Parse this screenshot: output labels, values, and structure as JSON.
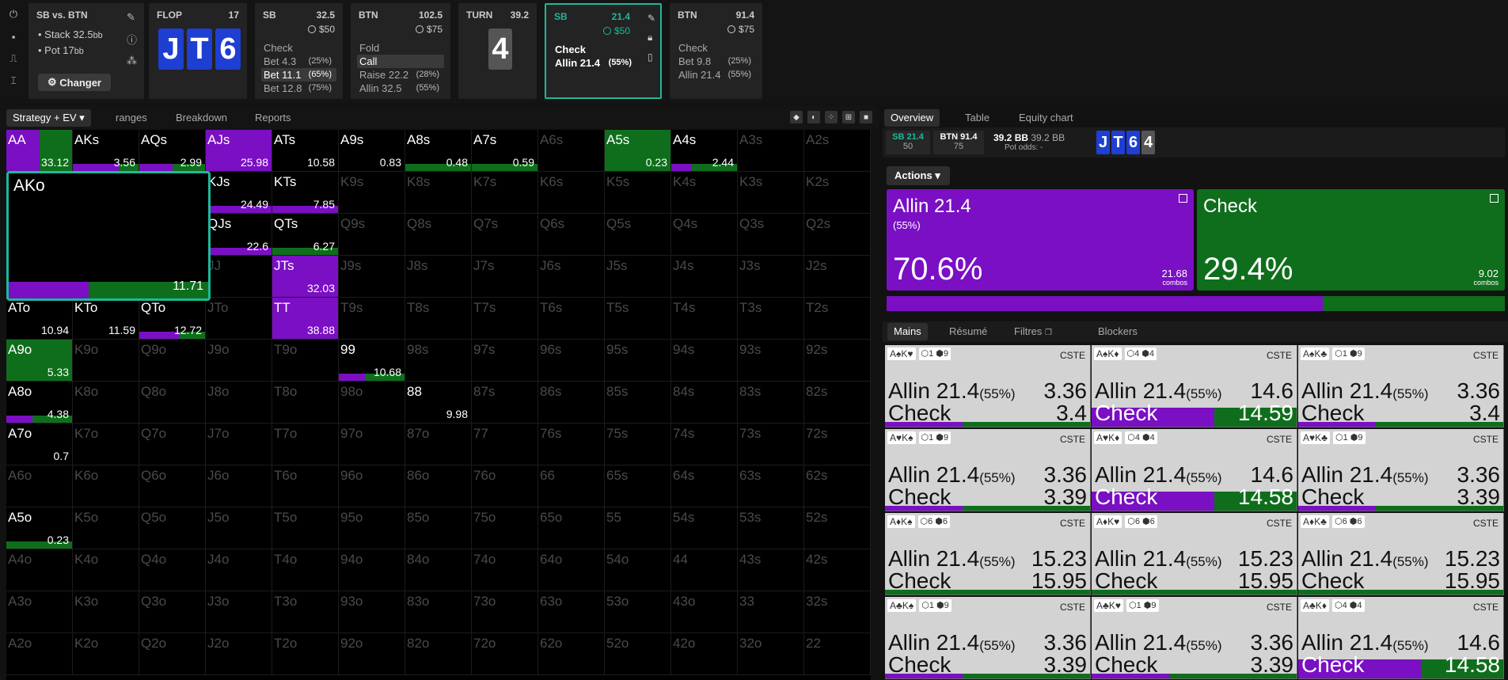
{
  "colors": {
    "allin": "#7a0fc4",
    "check": "#0f6e1c",
    "accent": "#1db89a"
  },
  "left_icons": [
    "power-icon",
    "save-icon",
    "gamepad-icon",
    "text-cursor-icon"
  ],
  "spot": {
    "title": "SB vs. BTN",
    "stack_label": "Stack 32.5",
    "stack_unit": "bb",
    "pot_label": "Pot 17",
    "pot_unit": "bb",
    "changer": "Changer"
  },
  "flop": {
    "title": "FLOP",
    "value": "17",
    "cards": [
      "J",
      "T",
      "6"
    ]
  },
  "sb1": {
    "title": "SB",
    "value": "32.5",
    "sub": "$50",
    "actions": [
      {
        "label": "Check",
        "pct": ""
      },
      {
        "label": "Bet 4.3",
        "pct": "(25%)"
      },
      {
        "label": "Bet 11.1",
        "pct": "(65%)"
      },
      {
        "label": "Bet 12.8",
        "pct": "(75%)"
      }
    ]
  },
  "btn1": {
    "title": "BTN",
    "value": "102.5",
    "sub": "$75",
    "actions": [
      {
        "label": "Fold",
        "pct": ""
      },
      {
        "label": "Call",
        "pct": ""
      },
      {
        "label": "Raise 22.2",
        "pct": "(28%)"
      },
      {
        "label": "Allin 32.5",
        "pct": "(55%)"
      }
    ]
  },
  "turn": {
    "title": "TURN",
    "value": "39.2",
    "card": "4"
  },
  "sb2": {
    "title": "SB",
    "value": "21.4",
    "sub": "$50",
    "actions": [
      {
        "label": "Check",
        "pct": ""
      },
      {
        "label": "Allin 21.4",
        "pct": "(55%)"
      }
    ]
  },
  "btn2": {
    "title": "BTN",
    "value": "91.4",
    "sub": "$75",
    "actions": [
      {
        "label": "Check",
        "pct": ""
      },
      {
        "label": "Bet 9.8",
        "pct": "(25%)"
      },
      {
        "label": "Allin 21.4",
        "pct": "(55%)"
      }
    ]
  },
  "left_tabs": [
    "Strategy + EV",
    "ranges",
    "Breakdown",
    "Reports"
  ],
  "grid": {
    "big_cell": {
      "name": "AKo",
      "ev": "11.71",
      "allin": 0.4,
      "check": 0.6
    }
  },
  "right_tabs": [
    "Overview",
    "Table",
    "Equity chart"
  ],
  "info": {
    "sb": "SB 21.4",
    "sb_sub": "50",
    "btn": "BTN 91.4",
    "btn_sub": "75",
    "pot": "39.2 BB",
    "pot2": "39.2 BB",
    "pot_odds": "Pot odds: -",
    "cards": [
      "J",
      "T",
      "6",
      "4"
    ]
  },
  "actions_btn": "Actions",
  "allin": {
    "label": "Allin 21.4",
    "size": "(55%)",
    "pct": "70.6%",
    "combos": "21.68",
    "combos_unit": "combos"
  },
  "check": {
    "label": "Check",
    "pct": "29.4%",
    "combos": "9.02",
    "combos_unit": "combos"
  },
  "hand_tabs": [
    "Mains",
    "Résumé",
    "Filtres",
    "Blockers"
  ],
  "hands": [
    {
      "cards": "A♠K♥",
      "b1": "1",
      "b2": "9",
      "cste": "CSTE",
      "a": "Allin 21.4",
      "a_pct": "(55%)",
      "av": "3.36",
      "c": "Check",
      "cv": "3.4",
      "allin": 0.38,
      "thick": false
    },
    {
      "cards": "A♠K♦",
      "b1": "4",
      "b2": "4",
      "cste": "CSTE",
      "a": "Allin 21.4",
      "a_pct": "(55%)",
      "av": "14.6",
      "c": "Check",
      "cv": "14.59",
      "allin": 0.6,
      "thick": true
    },
    {
      "cards": "A♠K♣",
      "b1": "1",
      "b2": "9",
      "cste": "CSTE",
      "a": "Allin 21.4",
      "a_pct": "(55%)",
      "av": "3.36",
      "c": "Check",
      "cv": "3.4",
      "allin": 0.38,
      "thick": false
    },
    {
      "cards": "A♥K♠",
      "b1": "1",
      "b2": "9",
      "cste": "CSTE",
      "a": "Allin 21.4",
      "a_pct": "(55%)",
      "av": "3.36",
      "c": "Check",
      "cv": "3.39",
      "allin": 0.38,
      "thick": false
    },
    {
      "cards": "A♥K♦",
      "b1": "4",
      "b2": "4",
      "cste": "CSTE",
      "a": "Allin 21.4",
      "a_pct": "(55%)",
      "av": "14.6",
      "c": "Check",
      "cv": "14.58",
      "allin": 0.6,
      "thick": true
    },
    {
      "cards": "A♥K♣",
      "b1": "1",
      "b2": "9",
      "cste": "CSTE",
      "a": "Allin 21.4",
      "a_pct": "(55%)",
      "av": "3.36",
      "c": "Check",
      "cv": "3.39",
      "allin": 0.38,
      "thick": false
    },
    {
      "cards": "A♦K♠",
      "b1": "6",
      "b2": "6",
      "cste": "CSTE",
      "a": "Allin 21.4",
      "a_pct": "(55%)",
      "av": "15.23",
      "c": "Check",
      "cv": "15.95",
      "allin": 0.0,
      "thick": false
    },
    {
      "cards": "A♦K♥",
      "b1": "6",
      "b2": "6",
      "cste": "CSTE",
      "a": "Allin 21.4",
      "a_pct": "(55%)",
      "av": "15.23",
      "c": "Check",
      "cv": "15.95",
      "allin": 0.0,
      "thick": false
    },
    {
      "cards": "A♦K♣",
      "b1": "6",
      "b2": "6",
      "cste": "CSTE",
      "a": "Allin 21.4",
      "a_pct": "(55%)",
      "av": "15.23",
      "c": "Check",
      "cv": "15.95",
      "allin": 0.0,
      "thick": false
    },
    {
      "cards": "A♣K♠",
      "b1": "1",
      "b2": "9",
      "cste": "CSTE",
      "a": "Allin 21.4",
      "a_pct": "(55%)",
      "av": "3.36",
      "c": "Check",
      "cv": "3.39",
      "allin": 0.38,
      "thick": false
    },
    {
      "cards": "A♣K♥",
      "b1": "1",
      "b2": "9",
      "cste": "CSTE",
      "a": "Allin 21.4",
      "a_pct": "(55%)",
      "av": "3.36",
      "c": "Check",
      "cv": "3.39",
      "allin": 0.38,
      "thick": false
    },
    {
      "cards": "A♣K♦",
      "b1": "4",
      "b2": "4",
      "cste": "CSTE",
      "a": "Allin 21.4",
      "a_pct": "(55%)",
      "av": "14.6",
      "c": "Check",
      "cv": "14.58",
      "allin": 0.6,
      "thick": true
    }
  ],
  "grid_cells": [
    {
      "r": 0,
      "c": 0,
      "name": "AA",
      "ev": "33.12",
      "allin": 0.5,
      "check": 0.5,
      "full": true
    },
    {
      "r": 0,
      "c": 1,
      "name": "AKs",
      "ev": "3.56",
      "allin": 0.7,
      "check": 0.3
    },
    {
      "r": 0,
      "c": 2,
      "name": "AQs",
      "ev": "2.99",
      "allin": 0.5,
      "check": 0.5
    },
    {
      "r": 0,
      "c": 3,
      "name": "AJs",
      "ev": "25.98",
      "allin": 1,
      "check": 0,
      "full": true
    },
    {
      "r": 0,
      "c": 4,
      "name": "ATs",
      "ev": "10.58",
      "allin": 0,
      "check": 0
    },
    {
      "r": 0,
      "c": 5,
      "name": "A9s",
      "ev": "0.83",
      "allin": 0,
      "check": 0
    },
    {
      "r": 0,
      "c": 6,
      "name": "A8s",
      "ev": "0.48",
      "allin": 0,
      "check": 1
    },
    {
      "r": 0,
      "c": 7,
      "name": "A7s",
      "ev": "0.59",
      "allin": 0,
      "check": 1
    },
    {
      "r": 0,
      "c": 8,
      "name": "A6s",
      "dim": true
    },
    {
      "r": 0,
      "c": 9,
      "name": "A5s",
      "ev": "0.23",
      "allin": 0,
      "check": 1,
      "full": true
    },
    {
      "r": 0,
      "c": 10,
      "name": "A4s",
      "ev": "2.44",
      "allin": 0.3,
      "check": 0.7
    },
    {
      "r": 0,
      "c": 11,
      "name": "A3s",
      "dim": true
    },
    {
      "r": 0,
      "c": 12,
      "name": "A2s",
      "dim": true
    },
    {
      "r": 1,
      "c": 3,
      "name": "KJs",
      "ev": "24.49",
      "allin": 1,
      "check": 0
    },
    {
      "r": 1,
      "c": 4,
      "name": "KTs",
      "ev": "7.85",
      "allin": 1,
      "check": 0
    },
    {
      "r": 1,
      "c": 5,
      "name": "K9s",
      "dim": true
    },
    {
      "r": 1,
      "c": 6,
      "name": "K8s",
      "dim": true
    },
    {
      "r": 1,
      "c": 7,
      "name": "K7s",
      "dim": true
    },
    {
      "r": 1,
      "c": 8,
      "name": "K6s",
      "dim": true
    },
    {
      "r": 1,
      "c": 9,
      "name": "K5s",
      "dim": true
    },
    {
      "r": 1,
      "c": 10,
      "name": "K4s",
      "dim": true
    },
    {
      "r": 1,
      "c": 11,
      "name": "K3s",
      "dim": true
    },
    {
      "r": 1,
      "c": 12,
      "name": "K2s",
      "dim": true
    },
    {
      "r": 2,
      "c": 3,
      "name": "QJs",
      "ev": "22.6",
      "allin": 1,
      "check": 0
    },
    {
      "r": 2,
      "c": 4,
      "name": "QTs",
      "ev": "6.27",
      "allin": 0,
      "check": 1
    },
    {
      "r": 2,
      "c": 5,
      "name": "Q9s",
      "dim": true
    },
    {
      "r": 2,
      "c": 6,
      "name": "Q8s",
      "dim": true
    },
    {
      "r": 2,
      "c": 7,
      "name": "Q7s",
      "dim": true
    },
    {
      "r": 2,
      "c": 8,
      "name": "Q6s",
      "dim": true
    },
    {
      "r": 2,
      "c": 9,
      "name": "Q5s",
      "dim": true
    },
    {
      "r": 2,
      "c": 10,
      "name": "Q4s",
      "dim": true
    },
    {
      "r": 2,
      "c": 11,
      "name": "Q3s",
      "dim": true
    },
    {
      "r": 2,
      "c": 12,
      "name": "Q2s",
      "dim": true
    },
    {
      "r": 3,
      "c": 3,
      "name": "JJ",
      "dim": true
    },
    {
      "r": 3,
      "c": 4,
      "name": "JTs",
      "ev": "32.03",
      "allin": 1,
      "check": 0,
      "full": true
    },
    {
      "r": 3,
      "c": 5,
      "name": "J9s",
      "dim": true
    },
    {
      "r": 3,
      "c": 6,
      "name": "J8s",
      "dim": true
    },
    {
      "r": 3,
      "c": 7,
      "name": "J7s",
      "dim": true
    },
    {
      "r": 3,
      "c": 8,
      "name": "J6s",
      "dim": true
    },
    {
      "r": 3,
      "c": 9,
      "name": "J5s",
      "dim": true
    },
    {
      "r": 3,
      "c": 10,
      "name": "J4s",
      "dim": true
    },
    {
      "r": 3,
      "c": 11,
      "name": "J3s",
      "dim": true
    },
    {
      "r": 3,
      "c": 12,
      "name": "J2s",
      "dim": true
    },
    {
      "r": 4,
      "c": 0,
      "name": "ATo",
      "ev": "10.94",
      "allin": 0,
      "check": 0
    },
    {
      "r": 4,
      "c": 1,
      "name": "KTo",
      "ev": "11.59",
      "allin": 0,
      "check": 0
    },
    {
      "r": 4,
      "c": 2,
      "name": "QTo",
      "ev": "12.72",
      "allin": 0.6,
      "check": 0.4
    },
    {
      "r": 4,
      "c": 3,
      "name": "JTo",
      "dim": true
    },
    {
      "r": 4,
      "c": 4,
      "name": "TT",
      "ev": "38.88",
      "allin": 1,
      "check": 0,
      "full": true
    },
    {
      "r": 4,
      "c": 5,
      "name": "T9s",
      "dim": true
    },
    {
      "r": 4,
      "c": 6,
      "name": "T8s",
      "dim": true
    },
    {
      "r": 4,
      "c": 7,
      "name": "T7s",
      "dim": true
    },
    {
      "r": 4,
      "c": 8,
      "name": "T6s",
      "dim": true
    },
    {
      "r": 4,
      "c": 9,
      "name": "T5s",
      "dim": true
    },
    {
      "r": 4,
      "c": 10,
      "name": "T4s",
      "dim": true
    },
    {
      "r": 4,
      "c": 11,
      "name": "T3s",
      "dim": true
    },
    {
      "r": 4,
      "c": 12,
      "name": "T2s",
      "dim": true
    },
    {
      "r": 5,
      "c": 0,
      "name": "A9o",
      "ev": "5.33",
      "allin": 0,
      "check": 1,
      "full": true
    },
    {
      "r": 5,
      "c": 1,
      "name": "K9o",
      "dim": true
    },
    {
      "r": 5,
      "c": 2,
      "name": "Q9o",
      "dim": true
    },
    {
      "r": 5,
      "c": 3,
      "name": "J9o",
      "dim": true
    },
    {
      "r": 5,
      "c": 4,
      "name": "T9o",
      "dim": true
    },
    {
      "r": 5,
      "c": 5,
      "name": "99",
      "ev": "10.68",
      "allin": 0.4,
      "check": 0.6
    },
    {
      "r": 5,
      "c": 6,
      "name": "98s",
      "dim": true
    },
    {
      "r": 5,
      "c": 7,
      "name": "97s",
      "dim": true
    },
    {
      "r": 5,
      "c": 8,
      "name": "96s",
      "dim": true
    },
    {
      "r": 5,
      "c": 9,
      "name": "95s",
      "dim": true
    },
    {
      "r": 5,
      "c": 10,
      "name": "94s",
      "dim": true
    },
    {
      "r": 5,
      "c": 11,
      "name": "93s",
      "dim": true
    },
    {
      "r": 5,
      "c": 12,
      "name": "92s",
      "dim": true
    },
    {
      "r": 6,
      "c": 0,
      "name": "A8o",
      "ev": "4.38",
      "allin": 0.4,
      "check": 0.6
    },
    {
      "r": 6,
      "c": 1,
      "name": "K8o",
      "dim": true
    },
    {
      "r": 6,
      "c": 2,
      "name": "Q8o",
      "dim": true
    },
    {
      "r": 6,
      "c": 3,
      "name": "J8o",
      "dim": true
    },
    {
      "r": 6,
      "c": 4,
      "name": "T8o",
      "dim": true
    },
    {
      "r": 6,
      "c": 5,
      "name": "98o",
      "dim": true
    },
    {
      "r": 6,
      "c": 6,
      "name": "88",
      "ev": "9.98",
      "allin": 0,
      "check": 0
    },
    {
      "r": 6,
      "c": 7,
      "name": "87s",
      "dim": true
    },
    {
      "r": 6,
      "c": 8,
      "name": "86s",
      "dim": true
    },
    {
      "r": 6,
      "c": 9,
      "name": "85s",
      "dim": true
    },
    {
      "r": 6,
      "c": 10,
      "name": "84s",
      "dim": true
    },
    {
      "r": 6,
      "c": 11,
      "name": "83s",
      "dim": true
    },
    {
      "r": 6,
      "c": 12,
      "name": "82s",
      "dim": true
    },
    {
      "r": 7,
      "c": 0,
      "name": "A7o",
      "ev": "0.7",
      "allin": 0,
      "check": 0
    },
    {
      "r": 7,
      "c": 1,
      "name": "K7o",
      "dim": true
    },
    {
      "r": 7,
      "c": 2,
      "name": "Q7o",
      "dim": true
    },
    {
      "r": 7,
      "c": 3,
      "name": "J7o",
      "dim": true
    },
    {
      "r": 7,
      "c": 4,
      "name": "T7o",
      "dim": true
    },
    {
      "r": 7,
      "c": 5,
      "name": "97o",
      "dim": true
    },
    {
      "r": 7,
      "c": 6,
      "name": "87o",
      "dim": true
    },
    {
      "r": 7,
      "c": 7,
      "name": "77",
      "dim": true
    },
    {
      "r": 7,
      "c": 8,
      "name": "76s",
      "dim": true
    },
    {
      "r": 7,
      "c": 9,
      "name": "75s",
      "dim": true
    },
    {
      "r": 7,
      "c": 10,
      "name": "74s",
      "dim": true
    },
    {
      "r": 7,
      "c": 11,
      "name": "73s",
      "dim": true
    },
    {
      "r": 7,
      "c": 12,
      "name": "72s",
      "dim": true
    },
    {
      "r": 8,
      "c": 0,
      "name": "A6o",
      "dim": true
    },
    {
      "r": 8,
      "c": 1,
      "name": "K6o",
      "dim": true
    },
    {
      "r": 8,
      "c": 2,
      "name": "Q6o",
      "dim": true
    },
    {
      "r": 8,
      "c": 3,
      "name": "J6o",
      "dim": true
    },
    {
      "r": 8,
      "c": 4,
      "name": "T6o",
      "dim": true
    },
    {
      "r": 8,
      "c": 5,
      "name": "96o",
      "dim": true
    },
    {
      "r": 8,
      "c": 6,
      "name": "86o",
      "dim": true
    },
    {
      "r": 8,
      "c": 7,
      "name": "76o",
      "dim": true
    },
    {
      "r": 8,
      "c": 8,
      "name": "66",
      "dim": true
    },
    {
      "r": 8,
      "c": 9,
      "name": "65s",
      "dim": true
    },
    {
      "r": 8,
      "c": 10,
      "name": "64s",
      "dim": true
    },
    {
      "r": 8,
      "c": 11,
      "name": "63s",
      "dim": true
    },
    {
      "r": 8,
      "c": 12,
      "name": "62s",
      "dim": true
    },
    {
      "r": 9,
      "c": 0,
      "name": "A5o",
      "ev": "0.23",
      "allin": 0,
      "check": 1
    },
    {
      "r": 9,
      "c": 1,
      "name": "K5o",
      "dim": true
    },
    {
      "r": 9,
      "c": 2,
      "name": "Q5o",
      "dim": true
    },
    {
      "r": 9,
      "c": 3,
      "name": "J5o",
      "dim": true
    },
    {
      "r": 9,
      "c": 4,
      "name": "T5o",
      "dim": true
    },
    {
      "r": 9,
      "c": 5,
      "name": "95o",
      "dim": true
    },
    {
      "r": 9,
      "c": 6,
      "name": "85o",
      "dim": true
    },
    {
      "r": 9,
      "c": 7,
      "name": "75o",
      "dim": true
    },
    {
      "r": 9,
      "c": 8,
      "name": "65o",
      "dim": true
    },
    {
      "r": 9,
      "c": 9,
      "name": "55",
      "dim": true
    },
    {
      "r": 9,
      "c": 10,
      "name": "54s",
      "dim": true
    },
    {
      "r": 9,
      "c": 11,
      "name": "53s",
      "dim": true
    },
    {
      "r": 9,
      "c": 12,
      "name": "52s",
      "dim": true
    },
    {
      "r": 10,
      "c": 0,
      "name": "A4o",
      "dim": true
    },
    {
      "r": 10,
      "c": 1,
      "name": "K4o",
      "dim": true
    },
    {
      "r": 10,
      "c": 2,
      "name": "Q4o",
      "dim": true
    },
    {
      "r": 10,
      "c": 3,
      "name": "J4o",
      "dim": true
    },
    {
      "r": 10,
      "c": 4,
      "name": "T4o",
      "dim": true
    },
    {
      "r": 10,
      "c": 5,
      "name": "94o",
      "dim": true
    },
    {
      "r": 10,
      "c": 6,
      "name": "84o",
      "dim": true
    },
    {
      "r": 10,
      "c": 7,
      "name": "74o",
      "dim": true
    },
    {
      "r": 10,
      "c": 8,
      "name": "64o",
      "dim": true
    },
    {
      "r": 10,
      "c": 9,
      "name": "54o",
      "dim": true
    },
    {
      "r": 10,
      "c": 10,
      "name": "44",
      "dim": true
    },
    {
      "r": 10,
      "c": 11,
      "name": "43s",
      "dim": true
    },
    {
      "r": 10,
      "c": 12,
      "name": "42s",
      "dim": true
    },
    {
      "r": 11,
      "c": 0,
      "name": "A3o",
      "dim": true
    },
    {
      "r": 11,
      "c": 1,
      "name": "K3o",
      "dim": true
    },
    {
      "r": 11,
      "c": 2,
      "name": "Q3o",
      "dim": true
    },
    {
      "r": 11,
      "c": 3,
      "name": "J3o",
      "dim": true
    },
    {
      "r": 11,
      "c": 4,
      "name": "T3o",
      "dim": true
    },
    {
      "r": 11,
      "c": 5,
      "name": "93o",
      "dim": true
    },
    {
      "r": 11,
      "c": 6,
      "name": "83o",
      "dim": true
    },
    {
      "r": 11,
      "c": 7,
      "name": "73o",
      "dim": true
    },
    {
      "r": 11,
      "c": 8,
      "name": "63o",
      "dim": true
    },
    {
      "r": 11,
      "c": 9,
      "name": "53o",
      "dim": true
    },
    {
      "r": 11,
      "c": 10,
      "name": "43o",
      "dim": true
    },
    {
      "r": 11,
      "c": 11,
      "name": "33",
      "dim": true
    },
    {
      "r": 11,
      "c": 12,
      "name": "32s",
      "dim": true
    },
    {
      "r": 12,
      "c": 0,
      "name": "A2o",
      "dim": true
    },
    {
      "r": 12,
      "c": 1,
      "name": "K2o",
      "dim": true
    },
    {
      "r": 12,
      "c": 2,
      "name": "Q2o",
      "dim": true
    },
    {
      "r": 12,
      "c": 3,
      "name": "J2o",
      "dim": true
    },
    {
      "r": 12,
      "c": 4,
      "name": "T2o",
      "dim": true
    },
    {
      "r": 12,
      "c": 5,
      "name": "92o",
      "dim": true
    },
    {
      "r": 12,
      "c": 6,
      "name": "82o",
      "dim": true
    },
    {
      "r": 12,
      "c": 7,
      "name": "72o",
      "dim": true
    },
    {
      "r": 12,
      "c": 8,
      "name": "62o",
      "dim": true
    },
    {
      "r": 12,
      "c": 9,
      "name": "52o",
      "dim": true
    },
    {
      "r": 12,
      "c": 10,
      "name": "42o",
      "dim": true
    },
    {
      "r": 12,
      "c": 11,
      "name": "32o",
      "dim": true
    },
    {
      "r": 12,
      "c": 12,
      "name": "22",
      "dim": true
    }
  ]
}
